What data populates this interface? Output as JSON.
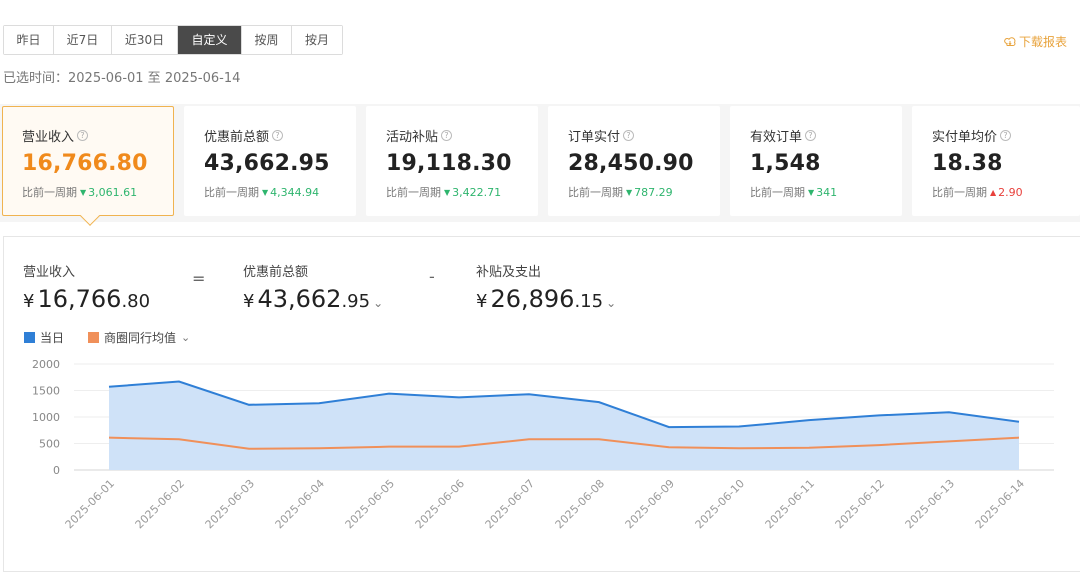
{
  "tabs": [
    {
      "label": "昨日",
      "active": false
    },
    {
      "label": "近7日",
      "active": false
    },
    {
      "label": "近30日",
      "active": false
    },
    {
      "label": "自定义",
      "active": true
    },
    {
      "label": "按周",
      "active": false
    },
    {
      "label": "按月",
      "active": false
    }
  ],
  "download_label": "下载报表",
  "range_text": "已选时间：2025-06-01 至 2025-06-14",
  "kpis": [
    {
      "label": "营业收入",
      "value": "16,766.80",
      "compare_label": "比前一周期",
      "delta": "3,061.61",
      "direction": "down",
      "active": true
    },
    {
      "label": "优惠前总额",
      "value": "43,662.95",
      "compare_label": "比前一周期",
      "delta": "4,344.94",
      "direction": "down",
      "active": false
    },
    {
      "label": "活动补贴",
      "value": "19,118.30",
      "compare_label": "比前一周期",
      "delta": "3,422.71",
      "direction": "down",
      "active": false
    },
    {
      "label": "订单实付",
      "value": "28,450.90",
      "compare_label": "比前一周期",
      "delta": "787.29",
      "direction": "down",
      "active": false
    },
    {
      "label": "有效订单",
      "value": "1,548",
      "compare_label": "比前一周期",
      "delta": "341",
      "direction": "down",
      "active": false
    },
    {
      "label": "实付单均价",
      "value": "18.38",
      "compare_label": "比前一周期",
      "delta": "2.90",
      "direction": "up",
      "active": false
    }
  ],
  "formula": {
    "revenue": {
      "label": "营业收入",
      "currency": "¥",
      "int": "16,766",
      "dec": ".80"
    },
    "equals": "=",
    "gross": {
      "label": "优惠前总额",
      "currency": "¥",
      "int": "43,662",
      "dec": ".95"
    },
    "minus": "-",
    "subsidy": {
      "label": "补贴及支出",
      "currency": "¥",
      "int": "26,896",
      "dec": ".15"
    }
  },
  "legend": {
    "current": "当日",
    "benchmark": "商圈同行均值"
  },
  "colors": {
    "accent": "#f08a1c",
    "down": "#2fb56e",
    "up": "#e8413c",
    "series_current": "#2f7fd6",
    "series_benchmark": "#f0905a"
  },
  "chart_data": {
    "type": "area",
    "x": [
      "2025-06-01",
      "2025-06-02",
      "2025-06-03",
      "2025-06-04",
      "2025-06-05",
      "2025-06-06",
      "2025-06-07",
      "2025-06-08",
      "2025-06-09",
      "2025-06-10",
      "2025-06-11",
      "2025-06-12",
      "2025-06-13",
      "2025-06-14"
    ],
    "series": [
      {
        "name": "当日",
        "values": [
          1570,
          1670,
          1230,
          1260,
          1440,
          1370,
          1430,
          1280,
          810,
          820,
          940,
          1030,
          1090,
          910
        ]
      },
      {
        "name": "商圈同行均值",
        "values": [
          610,
          580,
          400,
          410,
          440,
          440,
          580,
          580,
          430,
          410,
          420,
          470,
          540,
          610
        ]
      }
    ],
    "ylim": [
      0,
      2000
    ],
    "yticks": [
      0,
      500,
      1000,
      1500,
      2000
    ],
    "grid": true
  }
}
